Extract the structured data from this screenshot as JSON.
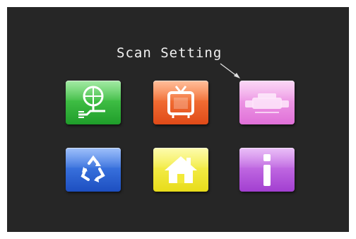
{
  "screen": {
    "caption": "Scan Setting"
  },
  "menu": {
    "items": [
      {
        "name": "connection-settings",
        "icon": "plug-globe-icon",
        "color": "#2fb53a"
      },
      {
        "name": "tv",
        "icon": "tv-icon",
        "color": "#f0602a"
      },
      {
        "name": "scan-setting",
        "icon": "scan-icon",
        "color": "#ec8fe4",
        "selected": true
      },
      {
        "name": "recycle",
        "icon": "recycle-icon",
        "color": "#2f6ddf"
      },
      {
        "name": "home",
        "icon": "home-icon",
        "color": "#f2ea3a"
      },
      {
        "name": "info",
        "icon": "info-icon",
        "color": "#bb5ee0"
      }
    ]
  }
}
